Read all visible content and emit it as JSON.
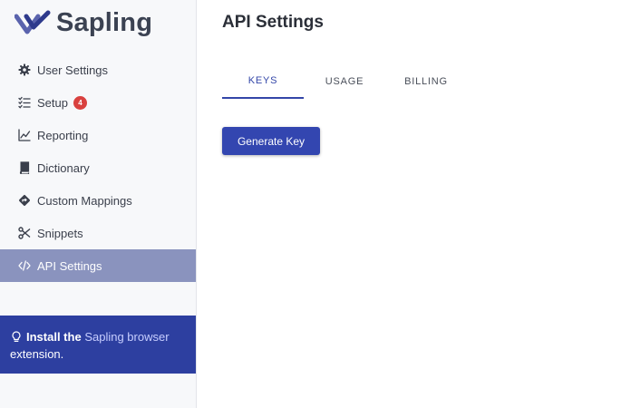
{
  "brand": {
    "name": "Sapling"
  },
  "sidebar": {
    "items": [
      {
        "label": "User Settings",
        "icon": "gear-icon"
      },
      {
        "label": "Setup",
        "icon": "checklist-icon",
        "badge": "4"
      },
      {
        "label": "Reporting",
        "icon": "line-chart-icon"
      },
      {
        "label": "Dictionary",
        "icon": "book-icon"
      },
      {
        "label": "Custom Mappings",
        "icon": "diamond-arrow-icon"
      },
      {
        "label": "Snippets",
        "icon": "scissors-icon"
      },
      {
        "label": "API Settings",
        "icon": "code-icon",
        "active": true
      }
    ]
  },
  "promo": {
    "prefix": "Install the",
    "link": "Sapling browser",
    "suffix": "extension."
  },
  "main": {
    "title": "API Settings",
    "tabs": [
      {
        "label": "KEYS",
        "active": true
      },
      {
        "label": "USAGE"
      },
      {
        "label": "BILLING"
      }
    ],
    "generate_button": "Generate Key"
  },
  "colors": {
    "accent": "#3346b0",
    "active_nav": "#8a93be",
    "promo_bg": "#2d3fa0",
    "badge": "#d9413f"
  }
}
